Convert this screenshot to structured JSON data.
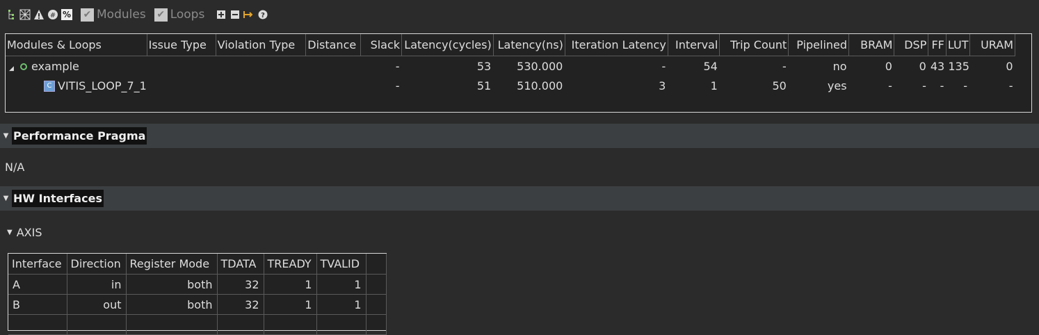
{
  "toolbar": {
    "icons": [
      "hierarchy-icon",
      "grid-icon",
      "warning-icon",
      "filter-icon",
      "percent-icon"
    ],
    "percent_label": "%",
    "modules_label": "Modules",
    "loops_label": "Loops",
    "modules_checked": true,
    "loops_checked": true
  },
  "summary_table": {
    "headers": [
      "Modules & Loops",
      "Issue Type",
      "Violation Type",
      "Distance",
      "Slack",
      "Latency(cycles)",
      "Latency(ns)",
      "Iteration Latency",
      "Interval",
      "Trip Count",
      "Pipelined",
      "BRAM",
      "DSP",
      "FF",
      "LUT",
      "URAM"
    ],
    "rows": [
      {
        "name": "example",
        "issue": "",
        "violation": "",
        "distance": "",
        "slack": "-",
        "lat_cycles": "53",
        "lat_ns": "530.000",
        "iter_lat": "-",
        "interval": "54",
        "trip": "-",
        "pipelined": "no",
        "bram": "0",
        "dsp": "0",
        "ff": "43",
        "lut": "135",
        "uram": "0"
      },
      {
        "name": "VITIS_LOOP_7_1",
        "issue": "",
        "violation": "",
        "distance": "",
        "slack": "-",
        "lat_cycles": "51",
        "lat_ns": "510.000",
        "iter_lat": "3",
        "interval": "1",
        "trip": "50",
        "pipelined": "yes",
        "bram": "-",
        "dsp": "-",
        "ff": "-",
        "lut": "-",
        "uram": "-"
      }
    ]
  },
  "performance_pragma": {
    "title": "Performance Pragma",
    "value": "N/A"
  },
  "hw_interfaces": {
    "title": "HW Interfaces",
    "axis_label": "AXIS",
    "headers": [
      "Interface",
      "Direction",
      "Register Mode",
      "TDATA",
      "TREADY",
      "TVALID"
    ],
    "rows": [
      {
        "iface": "A",
        "dir": "in",
        "mode": "both",
        "tdata": "32",
        "tready": "1",
        "tvalid": "1"
      },
      {
        "iface": "B",
        "dir": "out",
        "mode": "both",
        "tdata": "32",
        "tready": "1",
        "tvalid": "1"
      }
    ]
  }
}
